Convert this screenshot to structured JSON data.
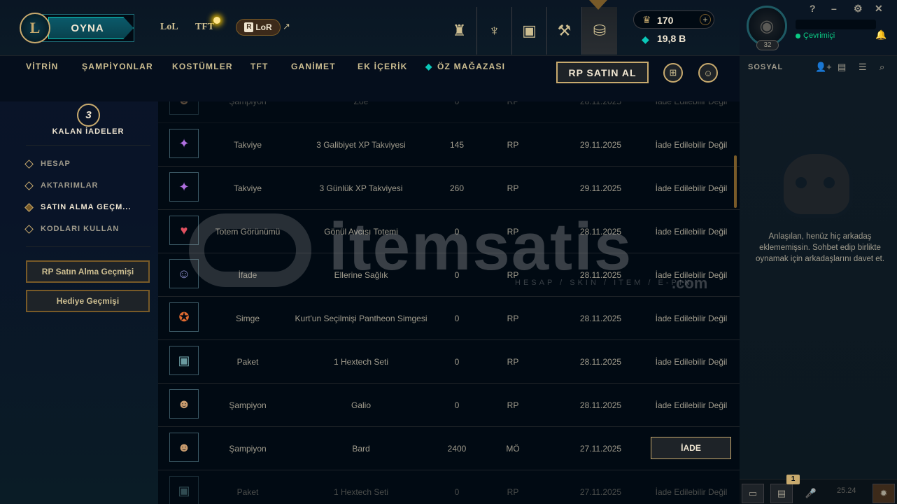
{
  "app": {
    "play_label": "OYNA",
    "logo_letter": "L"
  },
  "gamemodes": {
    "lol": "LoL",
    "tft": "TFT",
    "lor": "LoR",
    "lor_badge": "R",
    "external_glyph": "↗"
  },
  "nav_icons": [
    "trophy-icon",
    "ranked-icon",
    "collection-icon",
    "loot-icon",
    "store-icon"
  ],
  "currency": {
    "rp_value": "170",
    "be_value": "19,8 B",
    "plus": "+"
  },
  "profile": {
    "level": "32",
    "status": "Çevrimiçi"
  },
  "window": {
    "help": "?",
    "minimize": "–",
    "settings": "⚙",
    "close": "✕"
  },
  "subnav": [
    "VİTRİN",
    "ŞAMPİYONLAR",
    "KOSTÜMLER",
    "TFT",
    "GANİMET",
    "EK İÇERİK",
    "ÖZ MAĞAZASI"
  ],
  "rp_buy_label": "RP SATIN AL",
  "social": {
    "title": "SOSYAL",
    "empty_message": "Anlaşılan, henüz hiç arkadaş eklememişsin. Sohbet edip birlikte oynamak için arkadaşlarını davet et.",
    "badge_count": "1",
    "clock": "25.24"
  },
  "left_menu": {
    "refund_count": "3",
    "refund_label": "KALAN İADELER",
    "items": [
      {
        "label": "HESAP",
        "active": false
      },
      {
        "label": "AKTARIMLAR",
        "active": false
      },
      {
        "label": "SATIN ALMA GEÇM...",
        "active": true
      },
      {
        "label": "KODLARI KULLAN",
        "active": false
      }
    ],
    "rp_history": "RP Satın Alma Geçmişi",
    "gift_history": "Hediye Geçmişi"
  },
  "rows": [
    {
      "type": "Şampiyon",
      "name": "Zoe",
      "price": "0",
      "currency": "RP",
      "date": "28.11.2025",
      "refund": "İade Edilebilir Değil",
      "icon": "champion-icon",
      "faded": true
    },
    {
      "type": "Takviye",
      "name": "3 Galibiyet XP Takviyesi",
      "price": "145",
      "currency": "RP",
      "date": "29.11.2025",
      "refund": "İade Edilebilir Değil",
      "icon": "boost-icon"
    },
    {
      "type": "Takviye",
      "name": "3 Günlük XP Takviyesi",
      "price": "260",
      "currency": "RP",
      "date": "29.11.2025",
      "refund": "İade Edilebilir Değil",
      "icon": "boost-icon"
    },
    {
      "type": "Totem Görünümü",
      "name": "Gönül Avcısı Totemi",
      "price": "0",
      "currency": "RP",
      "date": "28.11.2025",
      "refund": "İade Edilebilir Değil",
      "icon": "ward-icon"
    },
    {
      "type": "İfade",
      "name": "Ellerine Sağlık",
      "price": "0",
      "currency": "RP",
      "date": "28.11.2025",
      "refund": "İade Edilebilir Değil",
      "icon": "emote-icon"
    },
    {
      "type": "Simge",
      "name": "Kurt'un Seçilmişi Pantheon Simgesi",
      "price": "0",
      "currency": "RP",
      "date": "28.11.2025",
      "refund": "İade Edilebilir Değil",
      "icon": "profile-icon"
    },
    {
      "type": "Paket",
      "name": "1 Hextech Seti",
      "price": "0",
      "currency": "RP",
      "date": "28.11.2025",
      "refund": "İade Edilebilir Değil",
      "icon": "chest-icon"
    },
    {
      "type": "Şampiyon",
      "name": "Galio",
      "price": "0",
      "currency": "RP",
      "date": "28.11.2025",
      "refund": "İade Edilebilir Değil",
      "icon": "champion-icon"
    },
    {
      "type": "Şampiyon",
      "name": "Bard",
      "price": "2400",
      "currency": "MÖ",
      "date": "27.11.2025",
      "refund": "İADE",
      "icon": "champion-icon",
      "refundable": true
    },
    {
      "type": "Paket",
      "name": "1 Hextech Seti",
      "price": "0",
      "currency": "RP",
      "date": "27.11.2025",
      "refund": "İade Edilebilir Değil",
      "icon": "chest-icon",
      "faded": true
    }
  ],
  "watermark": {
    "text": "itemsatis",
    "sub": "HESAP / SKIN / ITEM / E-PIN",
    "com": ".com"
  },
  "colors": {
    "gold": "#c8aa6e",
    "teal": "#0ac8b9",
    "online": "#0acb84",
    "bg": "#010a13"
  }
}
